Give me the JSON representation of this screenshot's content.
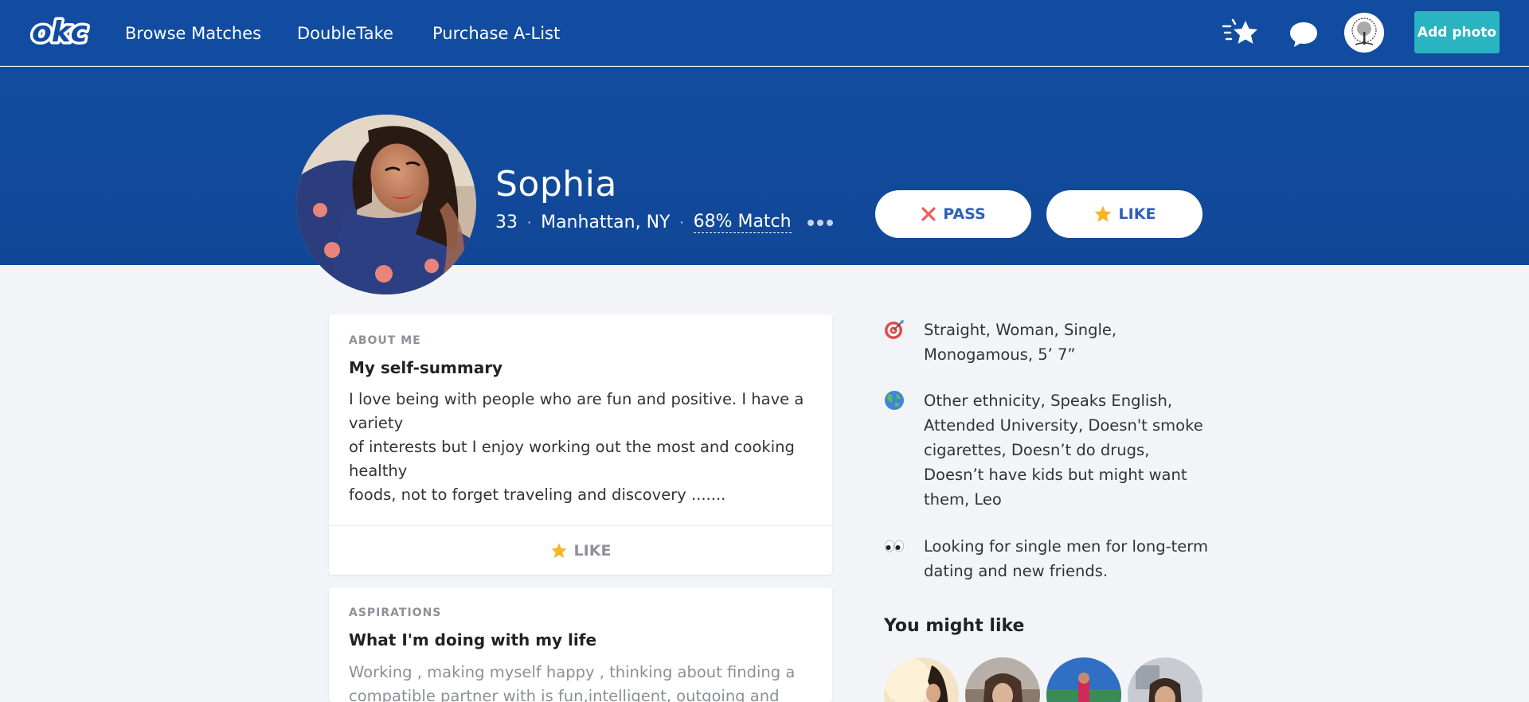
{
  "nav": {
    "logo_text": "okc",
    "links": [
      {
        "label": "Browse Matches"
      },
      {
        "label": "DoubleTake"
      },
      {
        "label": "Purchase A-List"
      }
    ],
    "icons": [
      "likes-star-icon",
      "messages-chat-icon"
    ],
    "add_photo_label": "Add photo"
  },
  "profile": {
    "name": "Sophia",
    "age": "33",
    "location": "Manhattan, NY",
    "match": "68% Match",
    "separator": "·",
    "pass_label": "PASS",
    "like_label": "LIKE"
  },
  "about": {
    "eyebrow": "ABOUT ME",
    "title": "My self-summary",
    "lines": [
      "I love being with people who are fun and positive. I have a",
      "variety",
      "of interests but I enjoy working out the most and cooking",
      "healthy",
      "foods, not to forget traveling and discovery ......."
    ],
    "like_label": "LIKE"
  },
  "aspirations": {
    "eyebrow": "ASPIRATIONS",
    "title": "What I'm doing with my life",
    "lines": [
      "Working , making myself happy , thinking about finding a",
      "compatible partner with is fun,intelligent, outgoing and"
    ]
  },
  "details": [
    {
      "icon": "target-icon",
      "lines": [
        "Straight, Woman, Single,",
        "Monogamous, 5’ 7”"
      ]
    },
    {
      "icon": "globe-icon",
      "lines": [
        "Other ethnicity, Speaks English,",
        "Attended University, Doesn't smoke",
        "cigarettes, Doesn’t do drugs,",
        "Doesn’t have kids but might want",
        "them, Leo"
      ]
    },
    {
      "icon": "eyes-icon",
      "lines": [
        "Looking for single men for long-term",
        "dating and new friends."
      ]
    }
  ],
  "you_might_like": {
    "title": "You might like"
  },
  "colors": {
    "brand_blue": "#124ca0",
    "accent_teal": "#2ab4c2",
    "pass_red": "#e8605a",
    "like_gold": "#f5b623",
    "page_bg": "#f3f4f8"
  }
}
